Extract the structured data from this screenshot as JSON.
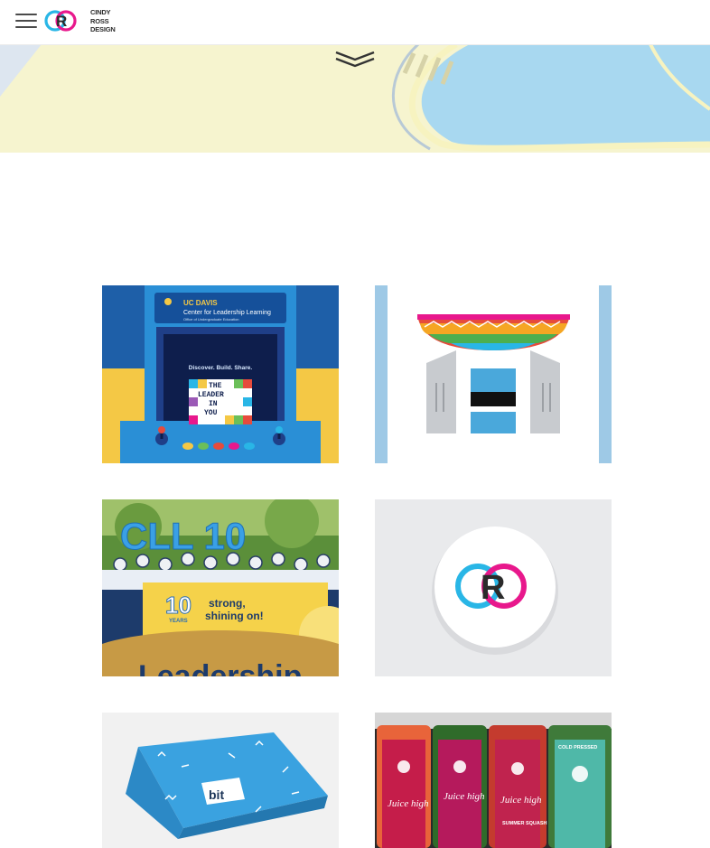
{
  "brand": {
    "line1": "CINDY",
    "line2": "ROSS",
    "line3": "DESIGN",
    "mark_letter": "R"
  },
  "hero": {
    "scroll_icon": "double-chevron-down-icon"
  },
  "portfolio": [
    {
      "id": "arcade",
      "header_line1": "UC DAVIS",
      "header_line2": "Center for Leadership Learning",
      "header_line3": "Office of Undergraduate Education",
      "screen_caption": "Discover. Build. Share.",
      "grid_words": [
        "THE",
        "LEADER",
        "IN",
        "YOU"
      ]
    },
    {
      "id": "pride-pillars"
    },
    {
      "id": "cll10",
      "balloon_text": "CLL 10",
      "banner_years": "10",
      "banner_years_label": "YEARS",
      "banner_line1": "strong,",
      "banner_line2": "shining on!",
      "bottom_text": "Leadership"
    },
    {
      "id": "cr-logo",
      "mark_letter": "R"
    },
    {
      "id": "bit-box",
      "box_label": "bit"
    },
    {
      "id": "juice-high",
      "bottle_label": "Juice high",
      "bottle_tag": "COLD PRESSED",
      "bottle_note": "SUMMER SQUASH"
    }
  ],
  "colors": {
    "cyan": "#29b6e6",
    "magenta": "#e8188c",
    "hero_bg": "#f6f4cf",
    "hero_water": "#a8d8f0"
  }
}
